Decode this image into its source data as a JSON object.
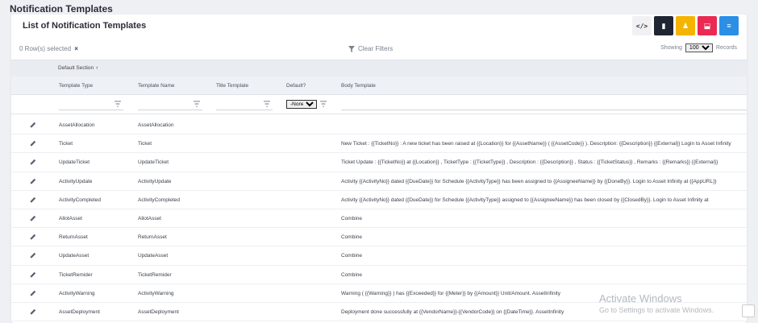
{
  "page_title": "Notification Templates",
  "card_title": "List of Notification Templates",
  "toolbar": [
    {
      "name": "code-button",
      "icon": "code-icon",
      "glyph": "</>"
    },
    {
      "name": "document-button",
      "icon": "document-icon",
      "glyph": "▮"
    },
    {
      "name": "user-button",
      "icon": "user-icon",
      "glyph": "♟"
    },
    {
      "name": "export-button",
      "icon": "export-icon",
      "glyph": "⬓"
    },
    {
      "name": "list-button",
      "icon": "list-icon",
      "glyph": "≡"
    }
  ],
  "selection": {
    "text": "0 Row(s) selected",
    "clear": "×"
  },
  "clear_filters": "Clear Filters",
  "showing": {
    "label": "Showing",
    "value": "100",
    "suffix": "Records"
  },
  "group": {
    "label": "Default Section",
    "chevron": "‹"
  },
  "columns": [
    "Template Type",
    "Template Name",
    "Title Template",
    "Default?",
    "Body Template"
  ],
  "default_filter": "-None-",
  "rows": [
    {
      "type": "AssetAllocation",
      "name": "AssetAllocation",
      "body": ""
    },
    {
      "type": "Ticket",
      "name": "Ticket",
      "body": "New Ticket : {{TicketNo}} : A new ticket has been raised at {{Location}} for {{AssetName}} ( {{AssetCode}} ). Description: {{Description}} {{External}} Login to Asset Infinity"
    },
    {
      "type": "UpdateTicket",
      "name": "UpdateTicket",
      "body": "Ticket Update : {{TicketNo}} at {{Location}} , TicketType : {{TicketType}} , Description : {{Description}} , Status : {{TicketStatus}} , Remarks : {{Remarks}} {{External}}"
    },
    {
      "type": "ActivityUpdate",
      "name": "ActivityUpdate",
      "body": "Activity {{ActivityNo}} dated {{DueDate}} for Schedule {{ActivityType}} has been assigned to {{AssigneeName}} by {{DoneBy}}. Login to Asset Infinity at {{AppURL}}"
    },
    {
      "type": "ActivityCompleted",
      "name": "ActivityCompleted",
      "body": "Activity {{ActivityNo}} dated {{DueDate}} for Schedule {{ActivityType}} assigned to {{AssigneeName}} has been closed by {{ClosedBy}}. Login to Asset Infinity at"
    },
    {
      "type": "AllotAsset",
      "name": "AllotAsset",
      "body": "Combine"
    },
    {
      "type": "ReturnAsset",
      "name": "ReturnAsset",
      "body": "Combine"
    },
    {
      "type": "UpdateAsset",
      "name": "UpdateAsset",
      "body": "Combine"
    },
    {
      "type": "TicketRemider",
      "name": "TicketRemider",
      "body": "Combine"
    },
    {
      "type": "ActivityWarning",
      "name": "ActivityWarning",
      "body": "Warning ( {{Warning}} ) has {{Exceeded}} for {{Meter}} by {{Amount}} Unit/Amount. AssetInfinity"
    },
    {
      "type": "AssetDeployment",
      "name": "AssetDeployment",
      "body": "Deployment done successfully at {{VendorName}}-{{VendorCode}} on {{DateTime}}. AssetInfinity"
    }
  ],
  "watermark": {
    "title": "Activate Windows",
    "subtitle": "Go to Settings to activate Windows."
  },
  "colors": {
    "accent": "#2c3e80",
    "dark": "#1f2533",
    "yellow": "#f5b400",
    "red": "#ea2a52",
    "blue": "#2b8fe6"
  }
}
